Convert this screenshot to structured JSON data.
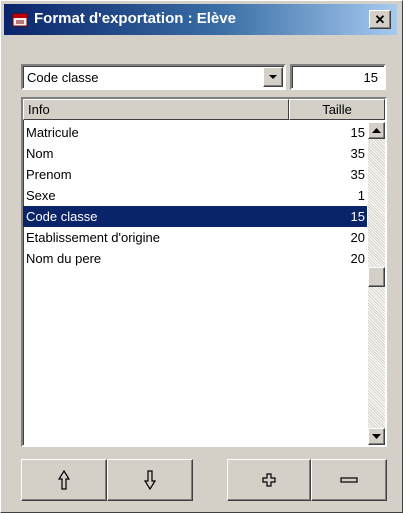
{
  "window": {
    "title": "Format d'exportation : Elève",
    "close_label": "✕"
  },
  "combo": {
    "selected": "Code classe",
    "size_value": "15"
  },
  "list": {
    "headers": {
      "info": "Info",
      "taille": "Taille"
    },
    "rows": [
      {
        "info": "Matricule",
        "taille": "15"
      },
      {
        "info": "Nom",
        "taille": "35"
      },
      {
        "info": "Prenom",
        "taille": "35"
      },
      {
        "info": "Sexe",
        "taille": "1"
      },
      {
        "info": "Code classe",
        "taille": "15",
        "selected": true
      },
      {
        "info": "Etablissement d'origine",
        "taille": "20"
      },
      {
        "info": "Nom du pere",
        "taille": "20"
      }
    ]
  },
  "toolbar": {
    "icons": [
      "move-up-icon",
      "move-down-icon",
      "add-icon",
      "remove-icon"
    ]
  },
  "colors": {
    "title_start": "#0a246a",
    "title_end": "#a6caf0",
    "selection": "#0a246a",
    "face": "#d4d0c8"
  }
}
